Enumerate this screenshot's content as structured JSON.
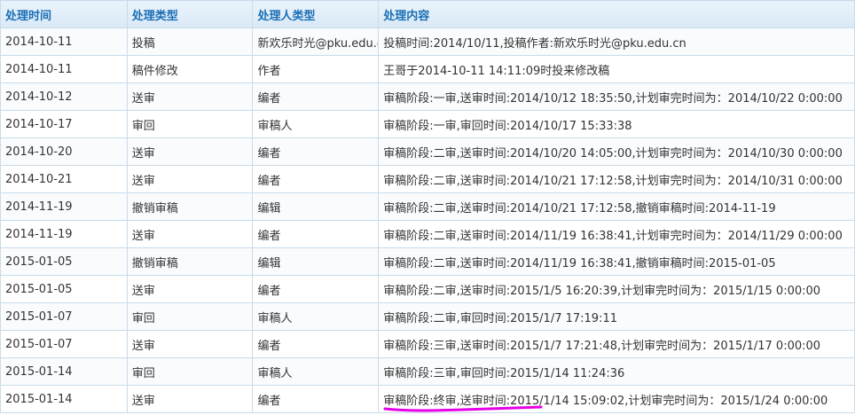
{
  "headers": {
    "time": "处理时间",
    "type": "处理类型",
    "handler": "处理人类型",
    "content": "处理内容"
  },
  "rows": [
    {
      "time": "2014-10-11",
      "type": "投稿",
      "handler": "新欢乐时光@pku.edu.cn",
      "content": "投稿时间:2014/10/11,投稿作者:新欢乐时光@pku.edu.cn"
    },
    {
      "time": "2014-10-11",
      "type": "稿件修改",
      "handler": "作者",
      "content": "王哥于2014-10-11 14:11:09时投来修改稿"
    },
    {
      "time": "2014-10-12",
      "type": "送审",
      "handler": "编者",
      "content": "审稿阶段:一审,送审时间:2014/10/12 18:35:50,计划审完时间为：2014/10/22 0:00:00"
    },
    {
      "time": "2014-10-17",
      "type": "审回",
      "handler": "审稿人",
      "content": "审稿阶段:一审,审回时间:2014/10/17 15:33:38"
    },
    {
      "time": "2014-10-20",
      "type": "送审",
      "handler": "编者",
      "content": "审稿阶段:二审,送审时间:2014/10/20 14:05:00,计划审完时间为：2014/10/30 0:00:00"
    },
    {
      "time": "2014-10-21",
      "type": "送审",
      "handler": "编者",
      "content": "审稿阶段:二审,送审时间:2014/10/21 17:12:58,计划审完时间为：2014/10/31 0:00:00"
    },
    {
      "time": "2014-11-19",
      "type": "撤销审稿",
      "handler": "编辑",
      "content": "审稿阶段:二审,送审时间:2014/10/21 17:12:58,撤销审稿时间:2014-11-19"
    },
    {
      "time": "2014-11-19",
      "type": "送审",
      "handler": "编者",
      "content": "审稿阶段:二审,送审时间:2014/11/19 16:38:41,计划审完时间为：2014/11/29 0:00:00"
    },
    {
      "time": "2015-01-05",
      "type": "撤销审稿",
      "handler": "编辑",
      "content": "审稿阶段:二审,送审时间:2014/11/19 16:38:41,撤销审稿时间:2015-01-05"
    },
    {
      "time": "2015-01-05",
      "type": "送审",
      "handler": "编者",
      "content": "审稿阶段:二审,送审时间:2015/1/5 16:20:39,计划审完时间为：2015/1/15 0:00:00"
    },
    {
      "time": "2015-01-07",
      "type": "审回",
      "handler": "审稿人",
      "content": "审稿阶段:二审,审回时间:2015/1/7 17:19:11"
    },
    {
      "time": "2015-01-07",
      "type": "送审",
      "handler": "编者",
      "content": "审稿阶段:三审,送审时间:2015/1/7 17:21:48,计划审完时间为：2015/1/17 0:00:00"
    },
    {
      "time": "2015-01-14",
      "type": "审回",
      "handler": "审稿人",
      "content": "审稿阶段:三审,审回时间:2015/1/14 11:24:36"
    },
    {
      "time": "2015-01-14",
      "type": "送审",
      "handler": "编者",
      "content": "审稿阶段:终审,送审时间:2015/1/14 15:09:02,计划审完时间为：2015/1/24 0:00:00"
    }
  ],
  "colors": {
    "header_text": "#1a6fb5",
    "border": "#c9dcea",
    "highlight_stroke": "#e600e6"
  }
}
